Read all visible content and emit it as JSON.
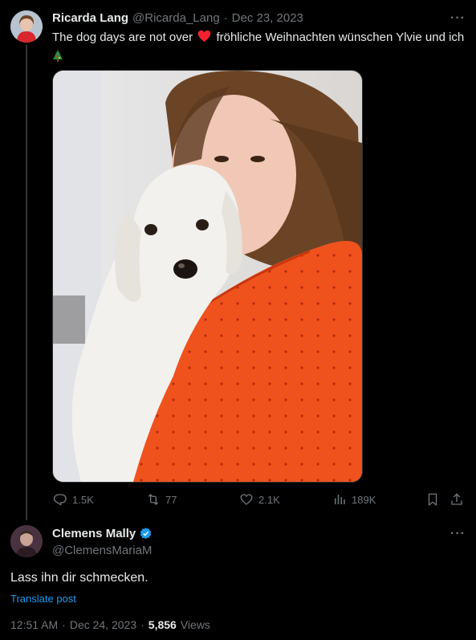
{
  "original_tweet": {
    "author_name": "Ricarda Lang",
    "author_handle": "@Ricarda_Lang",
    "separator": "·",
    "date": "Dec 23, 2023",
    "text_part1": "The dog days are not over",
    "text_part2": "fröhliche Weihnachten wünschen Ylvie und ich",
    "heart_emoji": "❤️",
    "tree_emoji": "🎄",
    "more_label": "···",
    "photo_description_icon": "photo-woman-with-dog",
    "actions": {
      "replies": "1.5K",
      "retweets": "77",
      "likes": "2.1K",
      "views": "189K"
    }
  },
  "reply_tweet": {
    "author_name": "Clemens Mally",
    "author_handle": "@ClemensMariaM",
    "verified": true,
    "more_label": "···",
    "text": "Lass ihn dir schmecken.",
    "translate_label": "Translate post",
    "time": "12:51 AM",
    "separator": "·",
    "date": "Dec 24, 2023",
    "separator2": "·",
    "views_count": "5,856",
    "views_label": "Views"
  },
  "colors": {
    "background": "#000000",
    "text_primary": "#e7e9ea",
    "text_muted": "#71767b",
    "link": "#1d9bf0",
    "heart": "#f4212e",
    "verified": "#1d9bf0"
  }
}
